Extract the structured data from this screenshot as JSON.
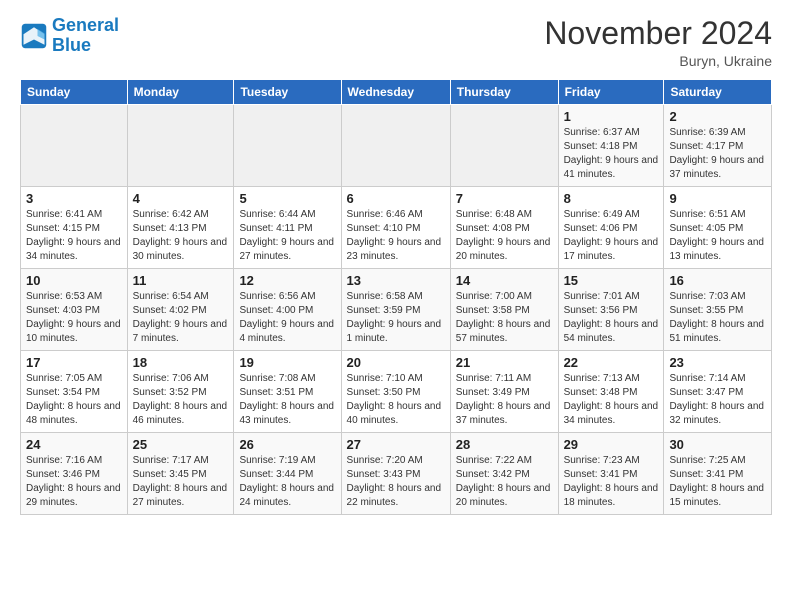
{
  "logo": {
    "line1": "General",
    "line2": "Blue"
  },
  "title": "November 2024",
  "location": "Buryn, Ukraine",
  "days_header": [
    "Sunday",
    "Monday",
    "Tuesday",
    "Wednesday",
    "Thursday",
    "Friday",
    "Saturday"
  ],
  "weeks": [
    [
      {
        "day": "",
        "info": ""
      },
      {
        "day": "",
        "info": ""
      },
      {
        "day": "",
        "info": ""
      },
      {
        "day": "",
        "info": ""
      },
      {
        "day": "",
        "info": ""
      },
      {
        "day": "1",
        "info": "Sunrise: 6:37 AM\nSunset: 4:18 PM\nDaylight: 9 hours and 41 minutes."
      },
      {
        "day": "2",
        "info": "Sunrise: 6:39 AM\nSunset: 4:17 PM\nDaylight: 9 hours and 37 minutes."
      }
    ],
    [
      {
        "day": "3",
        "info": "Sunrise: 6:41 AM\nSunset: 4:15 PM\nDaylight: 9 hours and 34 minutes."
      },
      {
        "day": "4",
        "info": "Sunrise: 6:42 AM\nSunset: 4:13 PM\nDaylight: 9 hours and 30 minutes."
      },
      {
        "day": "5",
        "info": "Sunrise: 6:44 AM\nSunset: 4:11 PM\nDaylight: 9 hours and 27 minutes."
      },
      {
        "day": "6",
        "info": "Sunrise: 6:46 AM\nSunset: 4:10 PM\nDaylight: 9 hours and 23 minutes."
      },
      {
        "day": "7",
        "info": "Sunrise: 6:48 AM\nSunset: 4:08 PM\nDaylight: 9 hours and 20 minutes."
      },
      {
        "day": "8",
        "info": "Sunrise: 6:49 AM\nSunset: 4:06 PM\nDaylight: 9 hours and 17 minutes."
      },
      {
        "day": "9",
        "info": "Sunrise: 6:51 AM\nSunset: 4:05 PM\nDaylight: 9 hours and 13 minutes."
      }
    ],
    [
      {
        "day": "10",
        "info": "Sunrise: 6:53 AM\nSunset: 4:03 PM\nDaylight: 9 hours and 10 minutes."
      },
      {
        "day": "11",
        "info": "Sunrise: 6:54 AM\nSunset: 4:02 PM\nDaylight: 9 hours and 7 minutes."
      },
      {
        "day": "12",
        "info": "Sunrise: 6:56 AM\nSunset: 4:00 PM\nDaylight: 9 hours and 4 minutes."
      },
      {
        "day": "13",
        "info": "Sunrise: 6:58 AM\nSunset: 3:59 PM\nDaylight: 9 hours and 1 minute."
      },
      {
        "day": "14",
        "info": "Sunrise: 7:00 AM\nSunset: 3:58 PM\nDaylight: 8 hours and 57 minutes."
      },
      {
        "day": "15",
        "info": "Sunrise: 7:01 AM\nSunset: 3:56 PM\nDaylight: 8 hours and 54 minutes."
      },
      {
        "day": "16",
        "info": "Sunrise: 7:03 AM\nSunset: 3:55 PM\nDaylight: 8 hours and 51 minutes."
      }
    ],
    [
      {
        "day": "17",
        "info": "Sunrise: 7:05 AM\nSunset: 3:54 PM\nDaylight: 8 hours and 48 minutes."
      },
      {
        "day": "18",
        "info": "Sunrise: 7:06 AM\nSunset: 3:52 PM\nDaylight: 8 hours and 46 minutes."
      },
      {
        "day": "19",
        "info": "Sunrise: 7:08 AM\nSunset: 3:51 PM\nDaylight: 8 hours and 43 minutes."
      },
      {
        "day": "20",
        "info": "Sunrise: 7:10 AM\nSunset: 3:50 PM\nDaylight: 8 hours and 40 minutes."
      },
      {
        "day": "21",
        "info": "Sunrise: 7:11 AM\nSunset: 3:49 PM\nDaylight: 8 hours and 37 minutes."
      },
      {
        "day": "22",
        "info": "Sunrise: 7:13 AM\nSunset: 3:48 PM\nDaylight: 8 hours and 34 minutes."
      },
      {
        "day": "23",
        "info": "Sunrise: 7:14 AM\nSunset: 3:47 PM\nDaylight: 8 hours and 32 minutes."
      }
    ],
    [
      {
        "day": "24",
        "info": "Sunrise: 7:16 AM\nSunset: 3:46 PM\nDaylight: 8 hours and 29 minutes."
      },
      {
        "day": "25",
        "info": "Sunrise: 7:17 AM\nSunset: 3:45 PM\nDaylight: 8 hours and 27 minutes."
      },
      {
        "day": "26",
        "info": "Sunrise: 7:19 AM\nSunset: 3:44 PM\nDaylight: 8 hours and 24 minutes."
      },
      {
        "day": "27",
        "info": "Sunrise: 7:20 AM\nSunset: 3:43 PM\nDaylight: 8 hours and 22 minutes."
      },
      {
        "day": "28",
        "info": "Sunrise: 7:22 AM\nSunset: 3:42 PM\nDaylight: 8 hours and 20 minutes."
      },
      {
        "day": "29",
        "info": "Sunrise: 7:23 AM\nSunset: 3:41 PM\nDaylight: 8 hours and 18 minutes."
      },
      {
        "day": "30",
        "info": "Sunrise: 7:25 AM\nSunset: 3:41 PM\nDaylight: 8 hours and 15 minutes."
      }
    ]
  ]
}
